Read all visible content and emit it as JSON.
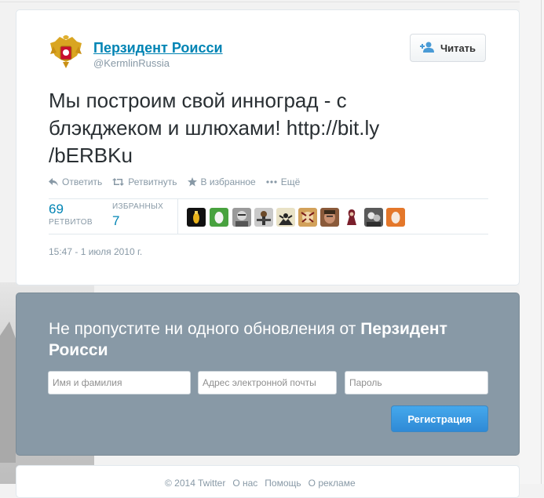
{
  "tweet": {
    "author_name": "Перзидент Роисси",
    "author_handle": "@KermlinRussia",
    "follow_label": "Читать",
    "text": "Мы построим свой инноград - с блэкджеком и шлюхами! http://bit.ly /bERBKu",
    "actions": {
      "reply": "Ответить",
      "retweet": "Ретвитнуть",
      "favorite": "В избранное",
      "more": "Ещё"
    },
    "stats": {
      "retweets_count": "69",
      "retweets_label": "РЕТВИТОВ",
      "favorites_label": "ИЗБРАННЫХ",
      "favorites_count": "7"
    },
    "timestamp": "15:47 - 1 июля 2010 г."
  },
  "signup": {
    "title_prefix": "Не пропустите ни одного обновления от ",
    "title_name": "Перзидент Роисси",
    "name_placeholder": "Имя и фамилия",
    "email_placeholder": "Адрес электронной почты",
    "password_placeholder": "Пароль",
    "register_label": "Регистрация"
  },
  "footer": {
    "copyright": "© 2014 Twitter",
    "about": "О нас",
    "help": "Помощь",
    "ads": "О рекламе"
  },
  "colors": {
    "link": "#0084b4",
    "muted": "#8899a6",
    "signup_bg": "#8899a6",
    "button_blue": "#2f8ad6"
  }
}
